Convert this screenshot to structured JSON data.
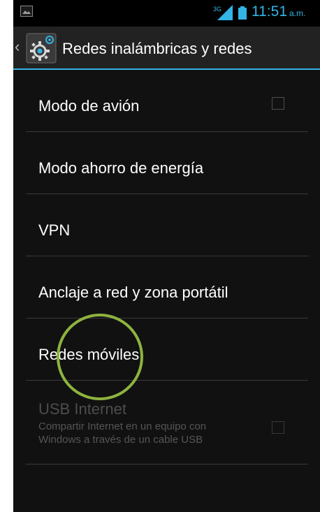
{
  "status_bar": {
    "signal_badge": "3G",
    "time": "11:51",
    "ampm": "a.m.",
    "accent_color": "#33b5e5",
    "icons": [
      "image-thumbnail-icon",
      "signal-3g-icon",
      "battery-icon"
    ]
  },
  "action_bar": {
    "title": "Redes inalámbricas y redes",
    "up_caret": "‹",
    "icon": "settings-gear-icon"
  },
  "preferences": [
    {
      "label": "Modo de avión",
      "has_checkbox": true,
      "checked": false,
      "enabled": true
    },
    {
      "label": "Modo ahorro de energía",
      "has_checkbox": false,
      "enabled": true
    },
    {
      "label": "VPN",
      "has_checkbox": false,
      "enabled": true
    },
    {
      "label": "Anclaje a red y zona portátil",
      "has_checkbox": false,
      "enabled": true
    },
    {
      "label": "Redes móviles",
      "has_checkbox": false,
      "enabled": true
    },
    {
      "label": "USB Internet",
      "summary": "Compartir Internet en un equipo con Windows a través de un cable USB",
      "has_checkbox": true,
      "checked": false,
      "enabled": false
    }
  ],
  "annotation": {
    "type": "highlight-circle",
    "color": "#8db33f",
    "target": "Redes móviles"
  }
}
